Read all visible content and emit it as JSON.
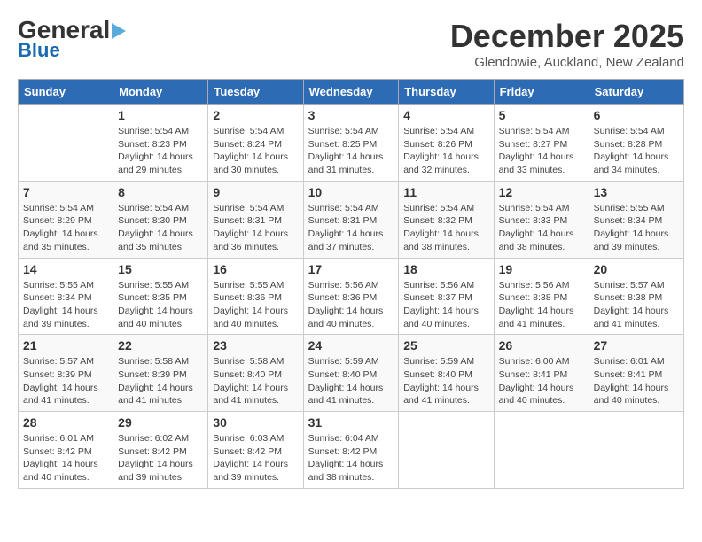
{
  "header": {
    "logo_general": "General",
    "logo_blue": "Blue",
    "month_title": "December 2025",
    "subtitle": "Glendowie, Auckland, New Zealand"
  },
  "weekdays": [
    "Sunday",
    "Monday",
    "Tuesday",
    "Wednesday",
    "Thursday",
    "Friday",
    "Saturday"
  ],
  "weeks": [
    [
      {
        "day": "",
        "sunrise": "",
        "sunset": "",
        "daylight": ""
      },
      {
        "day": "1",
        "sunrise": "Sunrise: 5:54 AM",
        "sunset": "Sunset: 8:23 PM",
        "daylight": "Daylight: 14 hours and 29 minutes."
      },
      {
        "day": "2",
        "sunrise": "Sunrise: 5:54 AM",
        "sunset": "Sunset: 8:24 PM",
        "daylight": "Daylight: 14 hours and 30 minutes."
      },
      {
        "day": "3",
        "sunrise": "Sunrise: 5:54 AM",
        "sunset": "Sunset: 8:25 PM",
        "daylight": "Daylight: 14 hours and 31 minutes."
      },
      {
        "day": "4",
        "sunrise": "Sunrise: 5:54 AM",
        "sunset": "Sunset: 8:26 PM",
        "daylight": "Daylight: 14 hours and 32 minutes."
      },
      {
        "day": "5",
        "sunrise": "Sunrise: 5:54 AM",
        "sunset": "Sunset: 8:27 PM",
        "daylight": "Daylight: 14 hours and 33 minutes."
      },
      {
        "day": "6",
        "sunrise": "Sunrise: 5:54 AM",
        "sunset": "Sunset: 8:28 PM",
        "daylight": "Daylight: 14 hours and 34 minutes."
      }
    ],
    [
      {
        "day": "7",
        "sunrise": "Sunrise: 5:54 AM",
        "sunset": "Sunset: 8:29 PM",
        "daylight": "Daylight: 14 hours and 35 minutes."
      },
      {
        "day": "8",
        "sunrise": "Sunrise: 5:54 AM",
        "sunset": "Sunset: 8:30 PM",
        "daylight": "Daylight: 14 hours and 35 minutes."
      },
      {
        "day": "9",
        "sunrise": "Sunrise: 5:54 AM",
        "sunset": "Sunset: 8:31 PM",
        "daylight": "Daylight: 14 hours and 36 minutes."
      },
      {
        "day": "10",
        "sunrise": "Sunrise: 5:54 AM",
        "sunset": "Sunset: 8:31 PM",
        "daylight": "Daylight: 14 hours and 37 minutes."
      },
      {
        "day": "11",
        "sunrise": "Sunrise: 5:54 AM",
        "sunset": "Sunset: 8:32 PM",
        "daylight": "Daylight: 14 hours and 38 minutes."
      },
      {
        "day": "12",
        "sunrise": "Sunrise: 5:54 AM",
        "sunset": "Sunset: 8:33 PM",
        "daylight": "Daylight: 14 hours and 38 minutes."
      },
      {
        "day": "13",
        "sunrise": "Sunrise: 5:55 AM",
        "sunset": "Sunset: 8:34 PM",
        "daylight": "Daylight: 14 hours and 39 minutes."
      }
    ],
    [
      {
        "day": "14",
        "sunrise": "Sunrise: 5:55 AM",
        "sunset": "Sunset: 8:34 PM",
        "daylight": "Daylight: 14 hours and 39 minutes."
      },
      {
        "day": "15",
        "sunrise": "Sunrise: 5:55 AM",
        "sunset": "Sunset: 8:35 PM",
        "daylight": "Daylight: 14 hours and 40 minutes."
      },
      {
        "day": "16",
        "sunrise": "Sunrise: 5:55 AM",
        "sunset": "Sunset: 8:36 PM",
        "daylight": "Daylight: 14 hours and 40 minutes."
      },
      {
        "day": "17",
        "sunrise": "Sunrise: 5:56 AM",
        "sunset": "Sunset: 8:36 PM",
        "daylight": "Daylight: 14 hours and 40 minutes."
      },
      {
        "day": "18",
        "sunrise": "Sunrise: 5:56 AM",
        "sunset": "Sunset: 8:37 PM",
        "daylight": "Daylight: 14 hours and 40 minutes."
      },
      {
        "day": "19",
        "sunrise": "Sunrise: 5:56 AM",
        "sunset": "Sunset: 8:38 PM",
        "daylight": "Daylight: 14 hours and 41 minutes."
      },
      {
        "day": "20",
        "sunrise": "Sunrise: 5:57 AM",
        "sunset": "Sunset: 8:38 PM",
        "daylight": "Daylight: 14 hours and 41 minutes."
      }
    ],
    [
      {
        "day": "21",
        "sunrise": "Sunrise: 5:57 AM",
        "sunset": "Sunset: 8:39 PM",
        "daylight": "Daylight: 14 hours and 41 minutes."
      },
      {
        "day": "22",
        "sunrise": "Sunrise: 5:58 AM",
        "sunset": "Sunset: 8:39 PM",
        "daylight": "Daylight: 14 hours and 41 minutes."
      },
      {
        "day": "23",
        "sunrise": "Sunrise: 5:58 AM",
        "sunset": "Sunset: 8:40 PM",
        "daylight": "Daylight: 14 hours and 41 minutes."
      },
      {
        "day": "24",
        "sunrise": "Sunrise: 5:59 AM",
        "sunset": "Sunset: 8:40 PM",
        "daylight": "Daylight: 14 hours and 41 minutes."
      },
      {
        "day": "25",
        "sunrise": "Sunrise: 5:59 AM",
        "sunset": "Sunset: 8:40 PM",
        "daylight": "Daylight: 14 hours and 41 minutes."
      },
      {
        "day": "26",
        "sunrise": "Sunrise: 6:00 AM",
        "sunset": "Sunset: 8:41 PM",
        "daylight": "Daylight: 14 hours and 40 minutes."
      },
      {
        "day": "27",
        "sunrise": "Sunrise: 6:01 AM",
        "sunset": "Sunset: 8:41 PM",
        "daylight": "Daylight: 14 hours and 40 minutes."
      }
    ],
    [
      {
        "day": "28",
        "sunrise": "Sunrise: 6:01 AM",
        "sunset": "Sunset: 8:42 PM",
        "daylight": "Daylight: 14 hours and 40 minutes."
      },
      {
        "day": "29",
        "sunrise": "Sunrise: 6:02 AM",
        "sunset": "Sunset: 8:42 PM",
        "daylight": "Daylight: 14 hours and 39 minutes."
      },
      {
        "day": "30",
        "sunrise": "Sunrise: 6:03 AM",
        "sunset": "Sunset: 8:42 PM",
        "daylight": "Daylight: 14 hours and 39 minutes."
      },
      {
        "day": "31",
        "sunrise": "Sunrise: 6:04 AM",
        "sunset": "Sunset: 8:42 PM",
        "daylight": "Daylight: 14 hours and 38 minutes."
      },
      {
        "day": "",
        "sunrise": "",
        "sunset": "",
        "daylight": ""
      },
      {
        "day": "",
        "sunrise": "",
        "sunset": "",
        "daylight": ""
      },
      {
        "day": "",
        "sunrise": "",
        "sunset": "",
        "daylight": ""
      }
    ]
  ]
}
